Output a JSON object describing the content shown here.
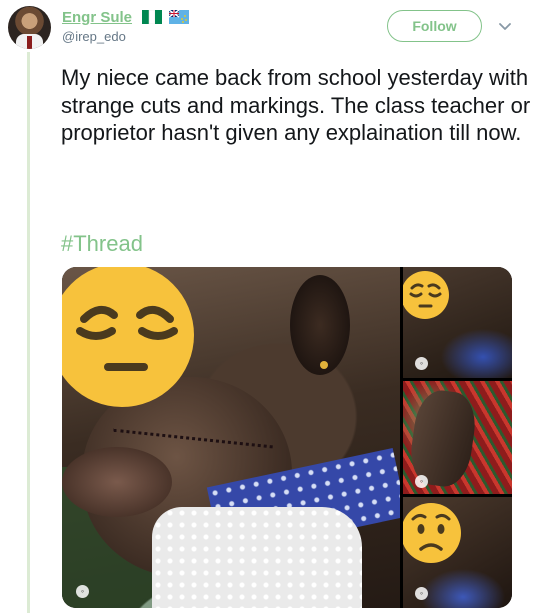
{
  "author": {
    "name": "Engr Sule",
    "handle": "@irep_edo",
    "flags": [
      "nigeria-flag-icon",
      "tuvalu-flag-icon"
    ]
  },
  "follow_button": {
    "label": "Follow"
  },
  "tweet": {
    "text": "My niece came back from school yesterday with strange cuts and markings.  The class teacher or proprietor hasn't given any explaination till now.",
    "hashtag": "#Thread"
  },
  "colors": {
    "accent": "#83c38a",
    "thread_line": "#dcebd4",
    "text": "#14171a",
    "muted": "#657786",
    "emoji_yellow": "#f7c23c"
  },
  "media": {
    "photos": [
      {
        "id": "main",
        "emoji": "pensive-face-icon"
      },
      {
        "id": "top-right",
        "emoji": "pensive-face-icon"
      },
      {
        "id": "middle-right",
        "emoji": null
      },
      {
        "id": "bottom-right",
        "emoji": "worried-face-icon"
      }
    ]
  }
}
